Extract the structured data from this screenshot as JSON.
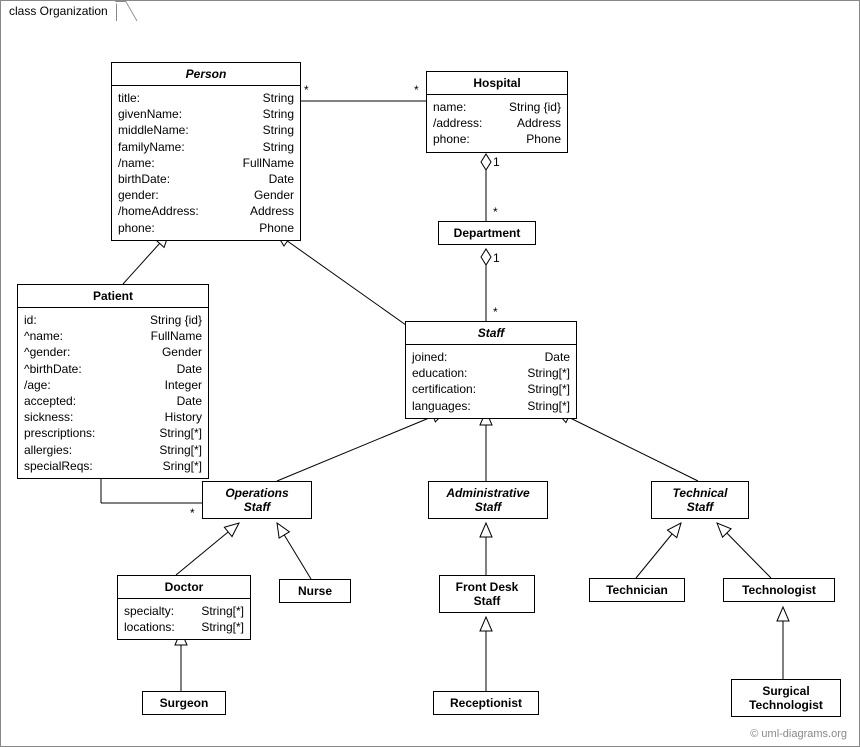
{
  "frame_title": "class Organization",
  "copyright": "© uml-diagrams.org",
  "classes": {
    "person": {
      "title": "Person",
      "attrs": [
        {
          "n": "title:",
          "t": "String"
        },
        {
          "n": "givenName:",
          "t": "String"
        },
        {
          "n": "middleName:",
          "t": "String"
        },
        {
          "n": "familyName:",
          "t": "String"
        },
        {
          "n": "/name:",
          "t": "FullName"
        },
        {
          "n": "birthDate:",
          "t": "Date"
        },
        {
          "n": "gender:",
          "t": "Gender"
        },
        {
          "n": "/homeAddress:",
          "t": "Address"
        },
        {
          "n": "phone:",
          "t": "Phone"
        }
      ]
    },
    "hospital": {
      "title": "Hospital",
      "attrs": [
        {
          "n": "name:",
          "t": "String {id}"
        },
        {
          "n": "/address:",
          "t": "Address"
        },
        {
          "n": "phone:",
          "t": "Phone"
        }
      ]
    },
    "department": {
      "title": "Department"
    },
    "patient": {
      "title": "Patient",
      "attrs": [
        {
          "n": "id:",
          "t": "String {id}"
        },
        {
          "n": "^name:",
          "t": "FullName"
        },
        {
          "n": "^gender:",
          "t": "Gender"
        },
        {
          "n": "^birthDate:",
          "t": "Date"
        },
        {
          "n": "/age:",
          "t": "Integer"
        },
        {
          "n": "accepted:",
          "t": "Date"
        },
        {
          "n": "sickness:",
          "t": "History"
        },
        {
          "n": "prescriptions:",
          "t": "String[*]"
        },
        {
          "n": "allergies:",
          "t": "String[*]"
        },
        {
          "n": "specialReqs:",
          "t": "Sring[*]"
        }
      ]
    },
    "staff": {
      "title": "Staff",
      "attrs": [
        {
          "n": "joined:",
          "t": "Date"
        },
        {
          "n": "education:",
          "t": "String[*]"
        },
        {
          "n": "certification:",
          "t": "String[*]"
        },
        {
          "n": "languages:",
          "t": "String[*]"
        }
      ]
    },
    "operations": {
      "title1": "Operations",
      "title2": "Staff"
    },
    "administrative": {
      "title1": "Administrative",
      "title2": "Staff"
    },
    "technical": {
      "title1": "Technical",
      "title2": "Staff"
    },
    "doctor": {
      "title": "Doctor",
      "attrs": [
        {
          "n": "specialty:",
          "t": "String[*]"
        },
        {
          "n": "locations:",
          "t": "String[*]"
        }
      ]
    },
    "nurse": {
      "title": "Nurse"
    },
    "frontdesk": {
      "title1": "Front Desk",
      "title2": "Staff"
    },
    "technician": {
      "title": "Technician"
    },
    "technologist": {
      "title": "Technologist"
    },
    "surgeon": {
      "title": "Surgeon"
    },
    "receptionist": {
      "title": "Receptionist"
    },
    "surgtech": {
      "title1": "Surgical",
      "title2": "Technologist"
    }
  },
  "mult": {
    "person_hosp_left": "*",
    "person_hosp_right": "*",
    "hosp_dept_top": "1",
    "hosp_dept_bottom": "*",
    "dept_staff_top": "1",
    "dept_staff_bottom": "*",
    "patient_ops_left": "*",
    "patient_ops_right": "*"
  }
}
